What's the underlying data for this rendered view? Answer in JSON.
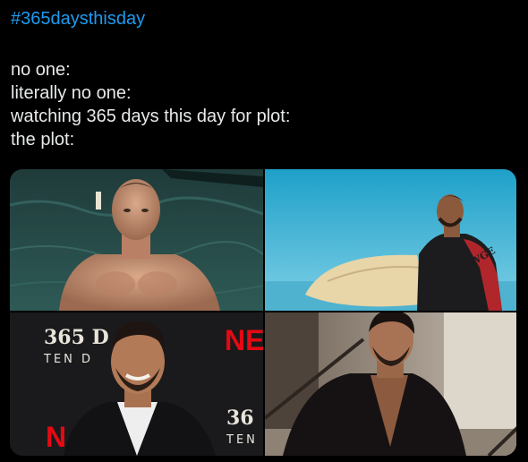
{
  "tweet": {
    "hashtag": "#365daysthisday",
    "lines": [
      "no one:",
      "literally no one:",
      "watching 365 days this day for plot:",
      "the plot:"
    ]
  },
  "media": {
    "photos": [
      {
        "name": "photo-pool"
      },
      {
        "name": "photo-surfboard",
        "shirt_text": "WGE"
      },
      {
        "name": "photo-red-carpet",
        "backdrop_text_1": "365 D",
        "backdrop_text_2": "TEN D",
        "logo_text": "NE",
        "backdrop_text_3": "36",
        "backdrop_text_4": "TEN",
        "logo_text_2": "N"
      },
      {
        "name": "photo-stairs"
      }
    ]
  },
  "colors": {
    "background": "#000000",
    "hashtag": "#1d9bf0",
    "text": "#e7e9ea",
    "netflix_red": "#e50914"
  }
}
